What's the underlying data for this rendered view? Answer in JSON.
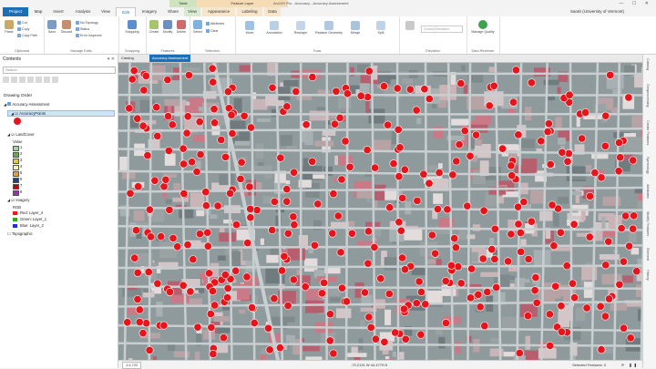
{
  "window": {
    "title": "ArcGIS Pro - Accuracy - Accuracy Assessment",
    "contextual_tabs": [
      "Table",
      "Feature Layer"
    ],
    "controls": "— ☐ ✕"
  },
  "ribbon_tabs": [
    "Project",
    "Map",
    "Insert",
    "Analysis",
    "View",
    "Edit",
    "Imagery",
    "Share",
    "View",
    "Appearance",
    "Labeling",
    "Data"
  ],
  "account": "Sarah (University of Vermont)",
  "ribbon_groups": {
    "clipboard": {
      "label": "Clipboard",
      "paste": "Paste",
      "cut": "Cut",
      "copy": "Copy",
      "copy_path": "Copy Path"
    },
    "manage_edits": {
      "label": "Manage Edits",
      "save": "Save",
      "discard": "Discard",
      "topology": "No Topology",
      "status": "Status",
      "error_inspector": "Error Inspector"
    },
    "snapping": {
      "label": "Snapping",
      "button": "Snapping"
    },
    "features": {
      "label": "Features",
      "create": "Create",
      "modify": "Modify",
      "delete": "Delete"
    },
    "selection": {
      "label": "Selection",
      "select": "Select",
      "attributes": "Attributes",
      "clear": "Clear"
    },
    "tools": {
      "label": "Tools",
      "move": "Move",
      "annotation": "Annotation",
      "reshape": "Reshape",
      "replace": "Replace Geometry",
      "merge": "Merge",
      "split": "Split"
    },
    "elevation": {
      "label": "Elevation",
      "mode": "Ground Elevation"
    },
    "data_reviewer": {
      "label": "Data Reviewer",
      "manage_quality": "Manage Quality"
    }
  },
  "contents": {
    "title": "Contents",
    "search_placeholder": "Search",
    "drawing_order": "Drawing Order",
    "map_name": "Accuracy Assessment",
    "point_layer": "AccuracyPoints",
    "landcover_layer": "LandCover",
    "value_label": "Value",
    "classes": [
      {
        "label": "1",
        "color": "#9fd49a"
      },
      {
        "label": "2",
        "color": "#6aa84f"
      },
      {
        "label": "3",
        "color": "#e6cf2e"
      },
      {
        "label": "4",
        "color": "#f3f3b5"
      },
      {
        "label": "5",
        "color": "#f29a3e"
      },
      {
        "label": "6",
        "color": "#1f3d8c"
      },
      {
        "label": "7",
        "color": "#c00000"
      },
      {
        "label": "8",
        "color": "#9b2fae"
      }
    ],
    "imagery_layer": "Imagery",
    "rgb_label": "RGB",
    "bands": [
      {
        "label": "Red: Layer_4",
        "color": "#e02020"
      },
      {
        "label": "Green: Layer_1",
        "color": "#20b020"
      },
      {
        "label": "Blue: Layer_2",
        "color": "#2030d0"
      }
    ],
    "topo_layer": "Topographic"
  },
  "map_tabs": [
    "Catalog",
    "Accuracy Assessment"
  ],
  "status": {
    "scale": "1:4,722",
    "coordinates": "-73.2131 W  44.4779 N",
    "selected": "Selected Features: 0"
  },
  "side_tabs": [
    "Catalog",
    "Geoprocessing",
    "Create Features",
    "Symbology",
    "Attributes",
    "Modify Features",
    "Element",
    "History"
  ],
  "colors": {
    "accent": "#1a6fb7",
    "point_fill": "#e8141b",
    "point_stroke": "#ffffff"
  }
}
